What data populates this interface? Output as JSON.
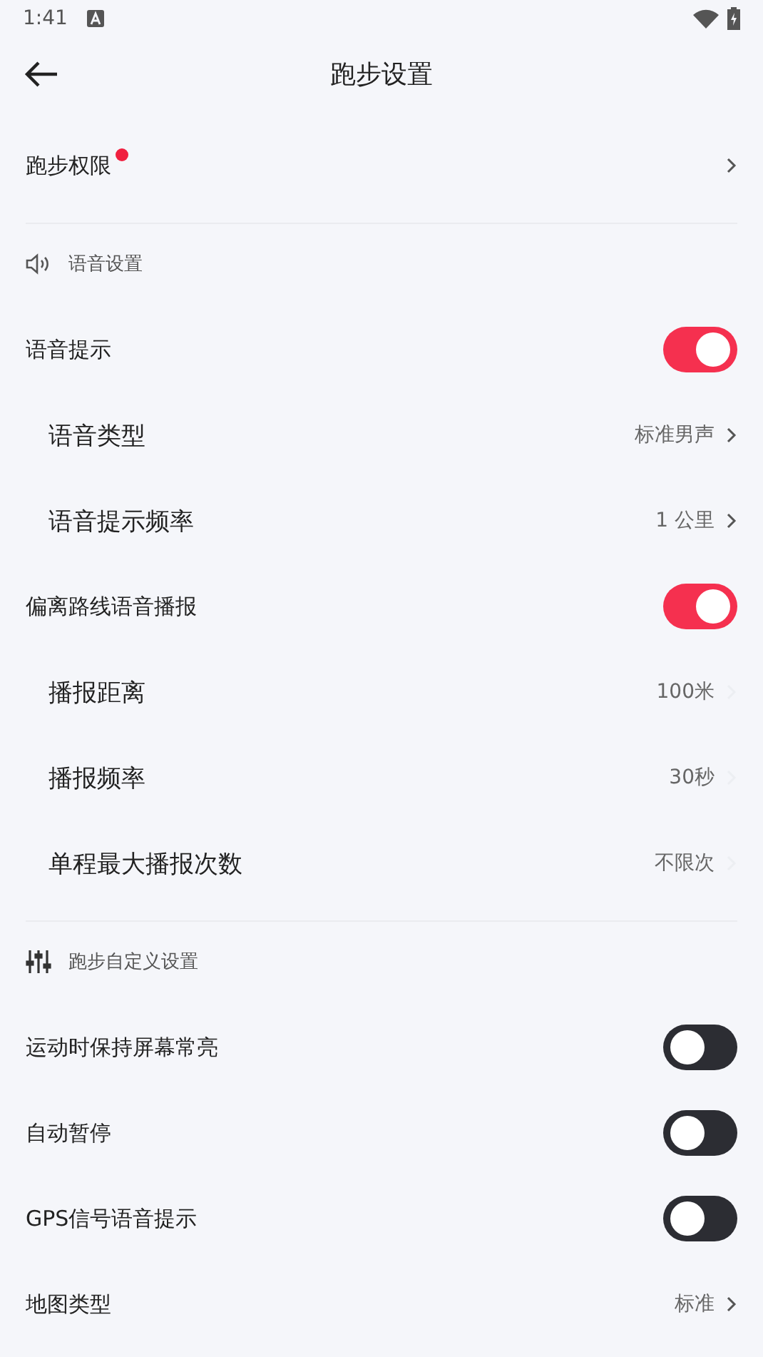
{
  "status_bar": {
    "time": "1:41"
  },
  "header": {
    "title": "跑步设置"
  },
  "groups": [
    {
      "items": [
        {
          "kind": "nav",
          "label": "跑步权限",
          "badge": true
        }
      ]
    },
    {
      "section": {
        "kind": "audio",
        "label": "语音设置"
      },
      "items": [
        {
          "kind": "toggle",
          "label": "语音提示",
          "on": true,
          "children": [
            {
              "kind": "nav",
              "label": "语音类型",
              "value": "标准男声",
              "chevron_faint": false
            },
            {
              "kind": "nav",
              "label": "语音提示频率",
              "value": "1 公里",
              "chevron_faint": false
            }
          ]
        },
        {
          "kind": "toggle",
          "label": "偏离路线语音播报",
          "on": true,
          "children": [
            {
              "kind": "nav",
              "label": "播报距离",
              "value": "100米",
              "chevron_faint": true
            },
            {
              "kind": "nav",
              "label": "播报频率",
              "value": "30秒",
              "chevron_faint": true
            },
            {
              "kind": "nav",
              "label": "单程最大播报次数",
              "value": "不限次",
              "chevron_faint": true
            }
          ]
        }
      ]
    },
    {
      "section": {
        "kind": "custom",
        "label": "跑步自定义设置"
      },
      "items": [
        {
          "kind": "toggle",
          "label": "运动时保持屏幕常亮",
          "on": false
        },
        {
          "kind": "toggle",
          "label": "自动暂停",
          "on": false
        },
        {
          "kind": "toggle",
          "label": "GPS信号语音提示",
          "on": false
        },
        {
          "kind": "nav",
          "label": "地图类型",
          "value": "标准",
          "chevron_faint": false
        }
      ]
    }
  ]
}
